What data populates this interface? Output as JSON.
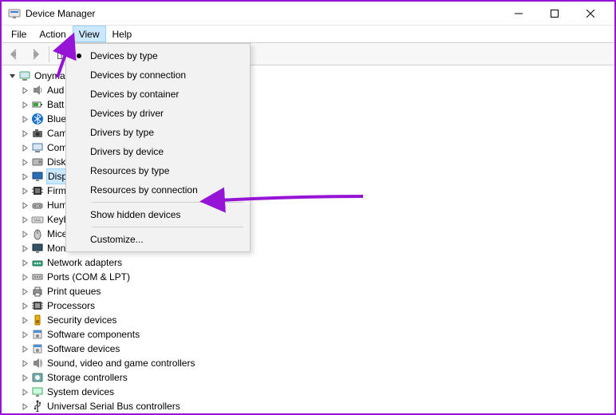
{
  "window": {
    "title": "Device Manager"
  },
  "menubar": {
    "file": "File",
    "action": "Action",
    "view": "View",
    "help": "Help",
    "open": "view"
  },
  "viewMenu": {
    "items": [
      {
        "label": "Devices by type",
        "checked": true
      },
      {
        "label": "Devices by connection",
        "checked": false
      },
      {
        "label": "Devices by container",
        "checked": false
      },
      {
        "label": "Devices by driver",
        "checked": false
      },
      {
        "label": "Drivers by type",
        "checked": false
      },
      {
        "label": "Drivers by device",
        "checked": false
      },
      {
        "label": "Resources by type",
        "checked": false
      },
      {
        "label": "Resources by connection",
        "checked": false
      }
    ],
    "showHidden": "Show hidden devices",
    "customize": "Customize..."
  },
  "tree": {
    "root": "Onyma",
    "nodes": [
      {
        "label": "Aud",
        "icon": "speaker"
      },
      {
        "label": "Batt",
        "icon": "battery"
      },
      {
        "label": "Blue",
        "icon": "bluetooth"
      },
      {
        "label": "Cam",
        "icon": "camera"
      },
      {
        "label": "Com",
        "icon": "computer"
      },
      {
        "label": "Disk",
        "icon": "disk"
      },
      {
        "label": "Disp",
        "icon": "display",
        "selected": true
      },
      {
        "label": "Firm",
        "icon": "chip"
      },
      {
        "label": "Hum",
        "icon": "hid"
      },
      {
        "label": "Keyb",
        "icon": "keyboard"
      },
      {
        "label": "Mice",
        "icon": "mouse"
      },
      {
        "label": "Monitors",
        "icon": "monitor"
      },
      {
        "label": "Network adapters",
        "icon": "network"
      },
      {
        "label": "Ports (COM & LPT)",
        "icon": "port"
      },
      {
        "label": "Print queues",
        "icon": "printer"
      },
      {
        "label": "Processors",
        "icon": "cpu"
      },
      {
        "label": "Security devices",
        "icon": "security"
      },
      {
        "label": "Software components",
        "icon": "software"
      },
      {
        "label": "Software devices",
        "icon": "software"
      },
      {
        "label": "Sound, video and game controllers",
        "icon": "sound"
      },
      {
        "label": "Storage controllers",
        "icon": "storage"
      },
      {
        "label": "System devices",
        "icon": "system"
      },
      {
        "label": "Universal Serial Bus controllers",
        "icon": "usb"
      }
    ]
  }
}
